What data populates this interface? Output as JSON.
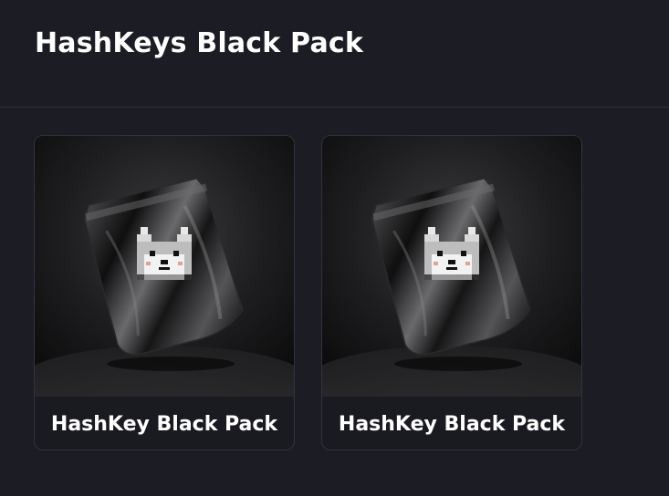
{
  "header": {
    "title": "HashKeys Black Pack"
  },
  "cards": [
    {
      "title": "HashKey Black Pack",
      "image_icon": "black-pack-wolf-icon"
    },
    {
      "title": "HashKey Black Pack",
      "image_icon": "black-pack-wolf-icon"
    }
  ]
}
